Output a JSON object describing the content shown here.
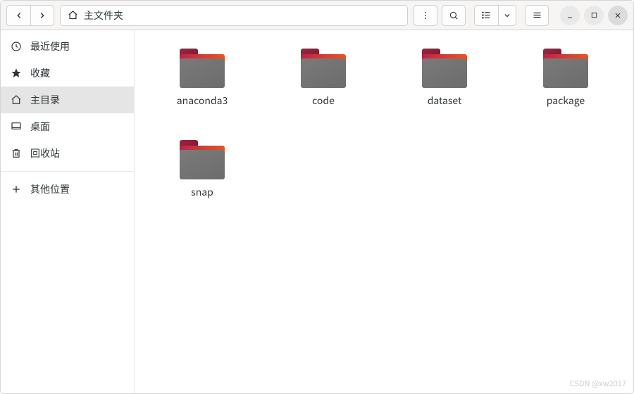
{
  "titlebar": {
    "path_label": "主文件夹"
  },
  "sidebar": {
    "items": [
      {
        "label": "最近使用",
        "icon": "clock"
      },
      {
        "label": "收藏",
        "icon": "star"
      },
      {
        "label": "主目录",
        "icon": "home",
        "selected": true
      },
      {
        "label": "桌面",
        "icon": "desktop"
      },
      {
        "label": "回收站",
        "icon": "trash"
      }
    ],
    "other": {
      "label": "其他位置",
      "icon": "plus"
    }
  },
  "folders": [
    {
      "name": "anaconda3"
    },
    {
      "name": "code"
    },
    {
      "name": "dataset"
    },
    {
      "name": "package"
    },
    {
      "name": "snap"
    }
  ],
  "watermark": "CSDN @xw2017"
}
